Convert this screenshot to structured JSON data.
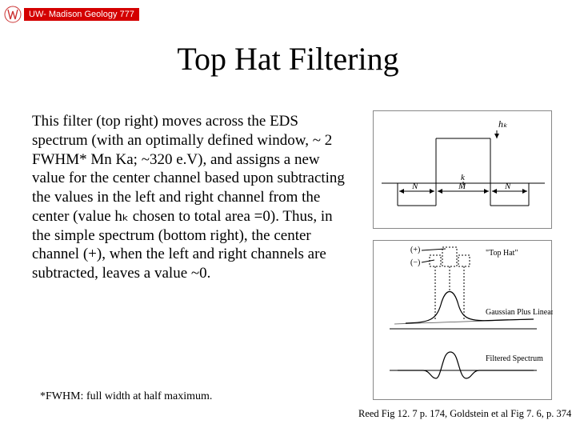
{
  "badge": {
    "label": "UW- Madison Geology 777"
  },
  "title": "Top Hat Filtering",
  "body": "This filter (top right) moves across the EDS spectrum (with an optimally defined window, ~ 2 FWHM* Mn Ka; ~320 e.V), and assigns a new value for the center channel based upon subtracting the values in the left and right channel from the center (value hₖ chosen to total area =0). Thus, in the simple spectrum (bottom right), the center channel (+), when the left and right channels are subtracted, leaves a value ~0.",
  "footnote": "*FWHM: full width at half maximum.",
  "citation": "Reed Fig 12. 7 p. 174, Goldstein et al Fig 7. 6, p. 374",
  "figure_top": {
    "label_hk": "hₖ",
    "label_N_left": "N",
    "label_M": "M",
    "label_N_right": "N",
    "label_k": "k"
  },
  "figure_bot": {
    "label_plus": "(+)",
    "label_minus": "(−)",
    "label_tophat": "\"Top Hat\"",
    "label_gaussian": "Gaussian Plus Linear",
    "label_filtered": "Filtered Spectrum"
  }
}
